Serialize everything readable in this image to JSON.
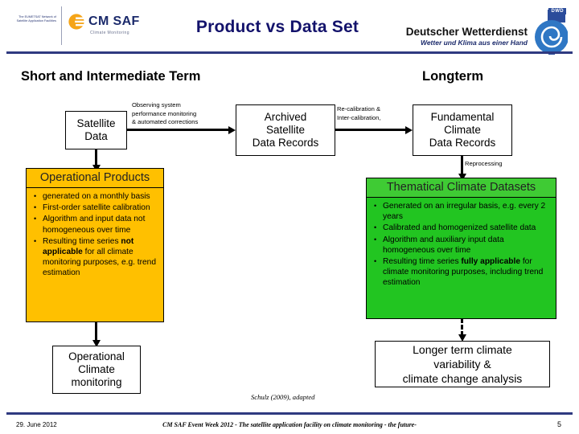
{
  "header": {
    "eumetsat_block": "The EUMETSAT Network of Satellite Application Facilities",
    "cmsaf_name": "CM SAF",
    "cmsaf_sub": "Climate Monitoring",
    "cmsaf_sun_icon": "sun-icon",
    "title": "Product vs Data Set",
    "dwd_name": "Deutscher Wetterdienst",
    "dwd_claim": "Wetter und Klima aus einer Hand",
    "dwd_tag": "DWD",
    "dwd_mark_icon": "dwd-spiral-icon"
  },
  "sections": {
    "short_term": "Short and Intermediate Term",
    "longterm": "Longterm"
  },
  "flow": {
    "satellite_data": "Satellite\nData",
    "archived": "Archived\nSatellite\nData Records",
    "fundamental": "Fundamental\nClimate\nData Records",
    "operational_climate": "Operational\nClimate\nmonitoring",
    "longer_term": "Longer term climate\nvariability &\nclimate change analysis"
  },
  "arrow_labels": {
    "observing": "Observing system\nperformance monitoring\n& automated corrections",
    "recalibration": "Re-calibration &\nInter-calibration,",
    "reprocessing": "Reprocessing"
  },
  "panels": {
    "operational": {
      "title": "Operational Products",
      "color": "#FFC000",
      "bullets": [
        [
          {
            "t": "generated on a monthly basis",
            "b": false
          }
        ],
        [
          {
            "t": "First-order satellite calibration",
            "b": false
          }
        ],
        [
          {
            "t": "Algorithm and input data not homogeneous over time",
            "b": false
          }
        ],
        [
          {
            "t": "Resulting time series ",
            "b": false
          },
          {
            "t": "not applicable",
            "b": true
          },
          {
            "t": " for all climate monitoring purposes, e.g. trend estimation",
            "b": false
          }
        ]
      ]
    },
    "thematical": {
      "title": "Thematical Climate Datasets",
      "color": "#22C521",
      "bullets": [
        [
          {
            "t": "Generated on an irregular basis, e.g. every 2 years",
            "b": false
          }
        ],
        [
          {
            "t": "Calibrated and homogenized satellite data",
            "b": false
          }
        ],
        [
          {
            "t": "Algorithm and auxiliary input data homogeneous over time",
            "b": false
          }
        ],
        [
          {
            "t": "Resulting time series ",
            "b": false
          },
          {
            "t": "fully applicable",
            "b": true
          },
          {
            "t": " for climate monitoring purposes, including trend estimation",
            "b": false
          }
        ]
      ]
    }
  },
  "credit": "Schulz (2009), adapted",
  "footer": {
    "date": "29. June 2012",
    "center": "CM SAF Event Week 2012 - The satellite application facility on climate monitoring - the future-",
    "page": "5"
  }
}
